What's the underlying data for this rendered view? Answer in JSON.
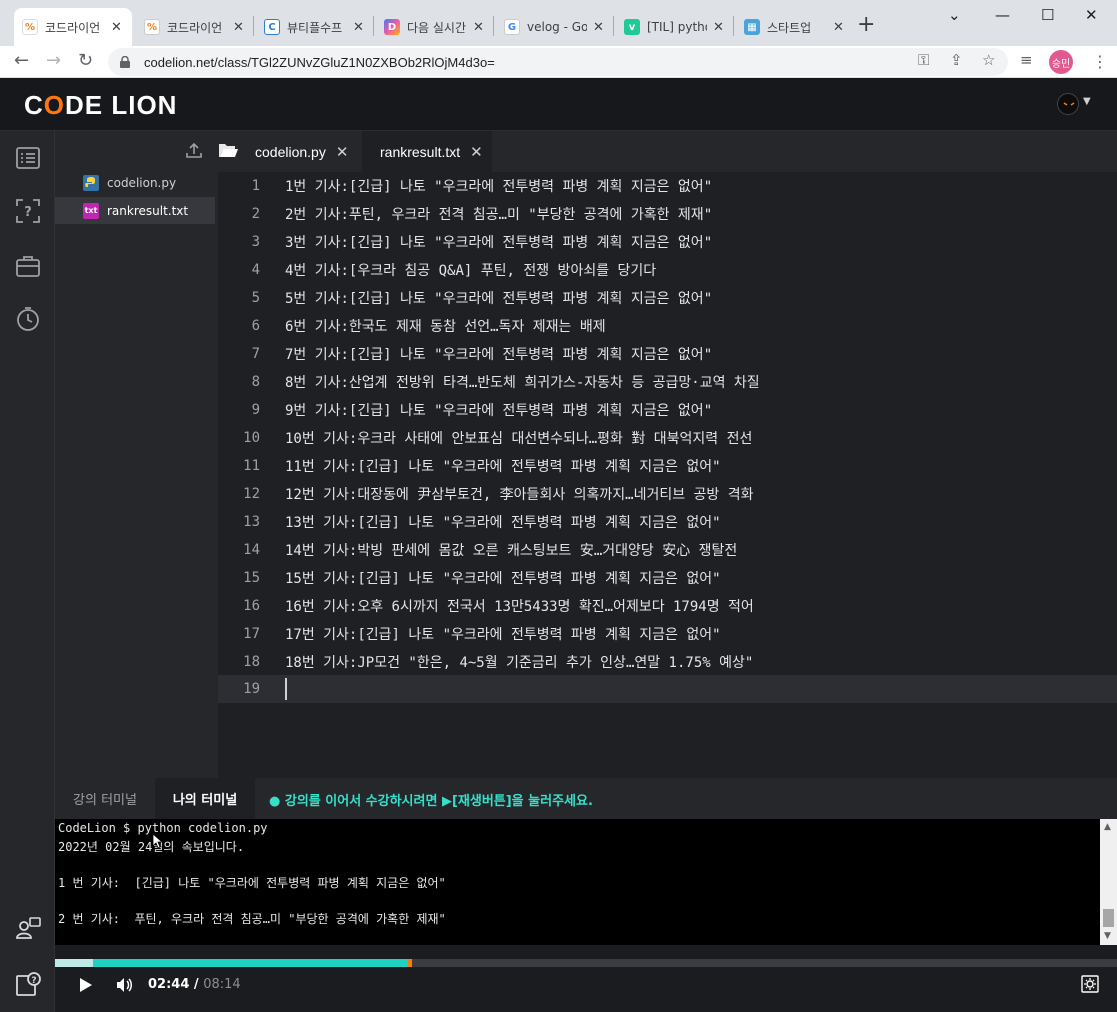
{
  "browser": {
    "tabs": [
      {
        "title": "코드라이언",
        "favicon": "codelion-icon",
        "active": true
      },
      {
        "title": "코드라이언",
        "favicon": "codelion-icon",
        "active": false
      },
      {
        "title": "뷰티플수프",
        "favicon": "c-icon",
        "active": false
      },
      {
        "title": "다음 실시간",
        "favicon": "daum-icon",
        "active": false
      },
      {
        "title": "velog - Go",
        "favicon": "google-icon",
        "active": false
      },
      {
        "title": "[TIL] pytho",
        "favicon": "velog-icon",
        "active": false
      },
      {
        "title": "스타트업",
        "favicon": "map-icon",
        "active": false
      }
    ],
    "url": "codelion.net/class/TGl2ZUNvZGluZ1N0ZXBOb2RlOjM4d3o=",
    "profile_label": "승민"
  },
  "app": {
    "logo": {
      "pre": "C",
      "o": "O",
      "post": "DE LION"
    }
  },
  "explorer": {
    "files": [
      {
        "name": "codelion.py",
        "icon": "python-icon",
        "active": false
      },
      {
        "name": "rankresult.txt",
        "icon": "txt-icon",
        "badge": "txt",
        "active": true
      }
    ]
  },
  "editor": {
    "tabs": [
      {
        "label": "codelion.py",
        "selected": false
      },
      {
        "label": "rankresult.txt",
        "selected": true
      }
    ],
    "lines": [
      {
        "n": "1",
        "text": "1번 기사:[긴급] 나토 \"우크라에 전투병력 파병 계획 지금은 없어\""
      },
      {
        "n": "2",
        "text": "2번 기사:푸틴, 우크라 전격 침공…미 \"부당한 공격에 가혹한 제재\""
      },
      {
        "n": "3",
        "text": "3번 기사:[긴급] 나토 \"우크라에 전투병력 파병 계획 지금은 없어\""
      },
      {
        "n": "4",
        "text": "4번 기사:[우크라 침공 Q&A] 푸틴, 전쟁 방아쇠를 당기다"
      },
      {
        "n": "5",
        "text": "5번 기사:[긴급] 나토 \"우크라에 전투병력 파병 계획 지금은 없어\""
      },
      {
        "n": "6",
        "text": "6번 기사:한국도 제재 동참 선언…독자 제재는 배제"
      },
      {
        "n": "7",
        "text": "7번 기사:[긴급] 나토 \"우크라에 전투병력 파병 계획 지금은 없어\""
      },
      {
        "n": "8",
        "text": "8번 기사:산업계 전방위 타격…반도체 희귀가스-자동차 등 공급망·교역 차질"
      },
      {
        "n": "9",
        "text": "9번 기사:[긴급] 나토 \"우크라에 전투병력 파병 계획 지금은 없어\""
      },
      {
        "n": "10",
        "text": "10번 기사:우크라 사태에 안보표심 대선변수되나…평화 對 대북억지력 전선"
      },
      {
        "n": "11",
        "text": "11번 기사:[긴급] 나토 \"우크라에 전투병력 파병 계획 지금은 없어\""
      },
      {
        "n": "12",
        "text": "12번 기사:대장동에 尹삼부토건, 李아들회사 의혹까지…네거티브 공방 격화"
      },
      {
        "n": "13",
        "text": "13번 기사:[긴급] 나토 \"우크라에 전투병력 파병 계획 지금은 없어\""
      },
      {
        "n": "14",
        "text": "14번 기사:박빙 판세에 몸값 오른 캐스팅보트 安…거대양당 安心 쟁탈전"
      },
      {
        "n": "15",
        "text": "15번 기사:[긴급] 나토 \"우크라에 전투병력 파병 계획 지금은 없어\""
      },
      {
        "n": "16",
        "text": "16번 기사:오후 6시까지 전국서 13만5433명 확진…어제보다 1794명 적어"
      },
      {
        "n": "17",
        "text": "17번 기사:[긴급] 나토 \"우크라에 전투병력 파병 계획 지금은 없어\""
      },
      {
        "n": "18",
        "text": "18번 기사:JP모건 \"한은, 4~5월 기준금리 추가 인상…연말 1.75% 예상\""
      },
      {
        "n": "19",
        "text": ""
      }
    ]
  },
  "terminal": {
    "tabs": [
      {
        "label": "강의 터미널",
        "active": false
      },
      {
        "label": "나의 터미널",
        "active": true
      }
    ],
    "notice": "● 강의를 이어서 수강하시려면 ▶[재생버튼]을 눌러주세요.",
    "output": [
      "CodeLion $ python codelion.py",
      "2022년 02월 24일의 속보입니다.",
      "",
      "1 번 기사:  [긴급] 나토 \"우크라에 전투병력 파병 계획 지금은 없어\"",
      "",
      "2 번 기사:  푸틴, 우크라 전격 침공…미 \"부당한 공격에 가혹한 제재\""
    ]
  },
  "player": {
    "current": "02:44",
    "separator": " / ",
    "total": "08:14",
    "progress_fraction": 0.3322,
    "buffered_fraction": 0.0355
  },
  "colors": {
    "accent": "#1fd1bf",
    "brand": "#ff7710",
    "progress_marker": "#ff7a00"
  }
}
